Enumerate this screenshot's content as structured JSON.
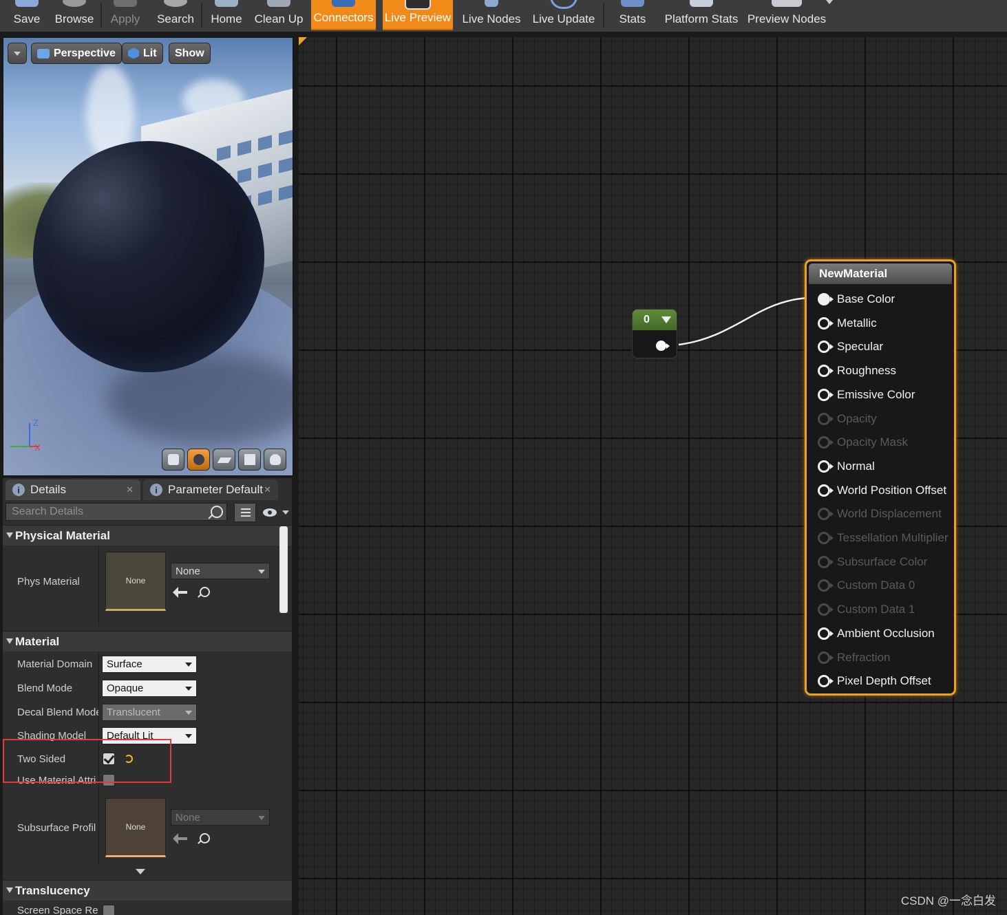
{
  "toolbar": {
    "buttons": [
      {
        "label": "Save",
        "state": "normal"
      },
      {
        "label": "Browse",
        "state": "normal"
      },
      {
        "label": "Apply",
        "state": "disabled"
      },
      {
        "label": "Search",
        "state": "normal"
      },
      {
        "label": "Home",
        "state": "normal"
      },
      {
        "label": "Clean Up",
        "state": "normal"
      },
      {
        "label": "Connectors",
        "state": "active"
      },
      {
        "label": "Live Preview",
        "state": "active"
      },
      {
        "label": "Live Nodes",
        "state": "normal"
      },
      {
        "label": "Live Update",
        "state": "normal"
      },
      {
        "label": "Stats",
        "state": "normal"
      },
      {
        "label": "Platform Stats",
        "state": "normal"
      },
      {
        "label": "Preview Nodes",
        "state": "normal"
      }
    ]
  },
  "viewport": {
    "view_mode": "Perspective",
    "lighting": "Lit",
    "show": "Show",
    "axis": {
      "z": "Z",
      "x": "X"
    },
    "preview_shapes": [
      "cylinder-icon",
      "sphere-icon",
      "plane-icon",
      "cube-icon",
      "teapot-icon"
    ],
    "active_shape": "sphere-icon"
  },
  "details": {
    "tabs": [
      {
        "label": "Details"
      },
      {
        "label": "Parameter Defaults"
      }
    ],
    "search": {
      "placeholder": "Search Details"
    },
    "physical_material": {
      "header": "Physical Material",
      "phys_material_label": "Phys Material",
      "thumb_text": "None",
      "value": "None"
    },
    "material": {
      "header": "Material",
      "domain_label": "Material Domain",
      "domain_value": "Surface",
      "blend_label": "Blend Mode",
      "blend_value": "Opaque",
      "decal_label": "Decal Blend Mode",
      "decal_value": "Translucent",
      "shading_label": "Shading Model",
      "shading_value": "Default Lit",
      "two_sided_label": "Two Sided",
      "two_sided": true,
      "use_attr_label": "Use Material Attri",
      "subsurface_label": "Subsurface Profil",
      "subsurface_thumb": "None",
      "subsurface_value": "None"
    },
    "translucency": {
      "header": "Translucency",
      "ssr_label": "Screen Space Ref"
    }
  },
  "graph": {
    "constant_node": {
      "value": "0"
    },
    "material_node": {
      "title": "NewMaterial",
      "pins": [
        {
          "label": "Base Color",
          "enabled": true,
          "connected": true
        },
        {
          "label": "Metallic",
          "enabled": true,
          "connected": false
        },
        {
          "label": "Specular",
          "enabled": true,
          "connected": false
        },
        {
          "label": "Roughness",
          "enabled": true,
          "connected": false
        },
        {
          "label": "Emissive Color",
          "enabled": true,
          "connected": false
        },
        {
          "label": "Opacity",
          "enabled": false,
          "connected": false
        },
        {
          "label": "Opacity Mask",
          "enabled": false,
          "connected": false
        },
        {
          "label": "Normal",
          "enabled": true,
          "connected": false
        },
        {
          "label": "World Position Offset",
          "enabled": true,
          "connected": false
        },
        {
          "label": "World Displacement",
          "enabled": false,
          "connected": false
        },
        {
          "label": "Tessellation Multiplier",
          "enabled": false,
          "connected": false
        },
        {
          "label": "Subsurface Color",
          "enabled": false,
          "connected": false
        },
        {
          "label": "Custom Data 0",
          "enabled": false,
          "connected": false
        },
        {
          "label": "Custom Data 1",
          "enabled": false,
          "connected": false
        },
        {
          "label": "Ambient Occlusion",
          "enabled": true,
          "connected": false
        },
        {
          "label": "Refraction",
          "enabled": false,
          "connected": false
        },
        {
          "label": "Pixel Depth Offset",
          "enabled": true,
          "connected": false
        }
      ]
    }
  },
  "watermark": "CSDN @一念白发",
  "colors": {
    "accent": "#f28a1a",
    "node_border": "#f0a020",
    "constant_header": "#4f7a30",
    "highlight": "#e03a3a"
  }
}
